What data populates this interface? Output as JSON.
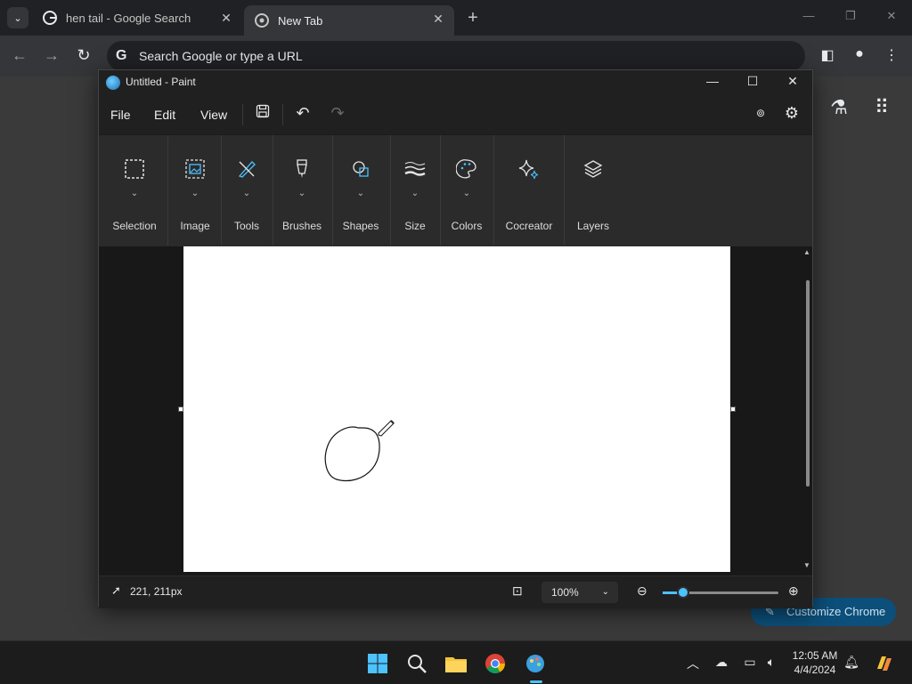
{
  "browser": {
    "tabs": [
      {
        "title": "hen tail - Google Search",
        "close": "✕"
      },
      {
        "title": "New Tab",
        "close": "✕"
      }
    ],
    "new_tab_symbol": "+",
    "omnibox_placeholder": "Search Google or type a URL",
    "customize_label": "Customize Chrome"
  },
  "paint": {
    "title": "Untitled - Paint",
    "menus": [
      "File",
      "Edit",
      "View"
    ],
    "ribbon_groups": [
      "Selection",
      "Image",
      "Tools",
      "Brushes",
      "Shapes",
      "Size",
      "Colors",
      "Cocreator",
      "Layers"
    ],
    "status": {
      "cursor_position": "221, 211px",
      "zoom": "100%"
    },
    "colors": {
      "accent": "#4cc2ff"
    }
  },
  "taskbar": {
    "time": "12:05 AM",
    "date": "4/4/2024"
  }
}
